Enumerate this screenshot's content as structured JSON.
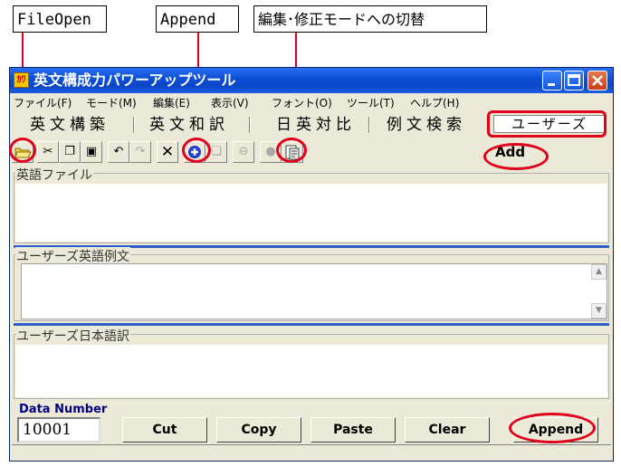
{
  "callouts": {
    "file_open": "FileOpen",
    "append": "Append",
    "mode_switch": "編集･修正モードへの切替",
    "add": "Add"
  },
  "window": {
    "title": "英文構成力パワーアップツール",
    "icon_text": "ｶﾜ"
  },
  "menu": [
    "ファイル(F)",
    "モード(M)",
    "編集(E)",
    "表示(V)",
    "フォント(O)",
    "ツール(T)",
    "ヘルプ(H)"
  ],
  "tabs": {
    "compose": "英文構築",
    "translate": "英文和訳",
    "compare": "日英対比",
    "search": "例文検索",
    "users": "ユーザーズ"
  },
  "toolbar_icons": [
    "folder-open-icon",
    "cut-icon",
    "copy-icon",
    "paste-icon",
    "undo-icon",
    "redo-icon",
    "delete-icon",
    "add-icon",
    "duplicate-icon",
    "remove-icon",
    "bullet-icon",
    "edit-mode-icon"
  ],
  "sections": {
    "english_file": "英語ファイル",
    "users_english": "ユーザーズ英語例文",
    "users_japanese": "ユーザーズ日本語訳"
  },
  "data_number": {
    "label": "Data Number",
    "value": "10001"
  },
  "buttons": {
    "cut": "Cut",
    "copy": "Copy",
    "paste": "Paste",
    "clear": "Clear",
    "append": "Append"
  },
  "colors": {
    "annotation_red": "#e0001a",
    "titlebar_blue": "#0a46c8",
    "divider_blue": "#2d5fc8"
  }
}
